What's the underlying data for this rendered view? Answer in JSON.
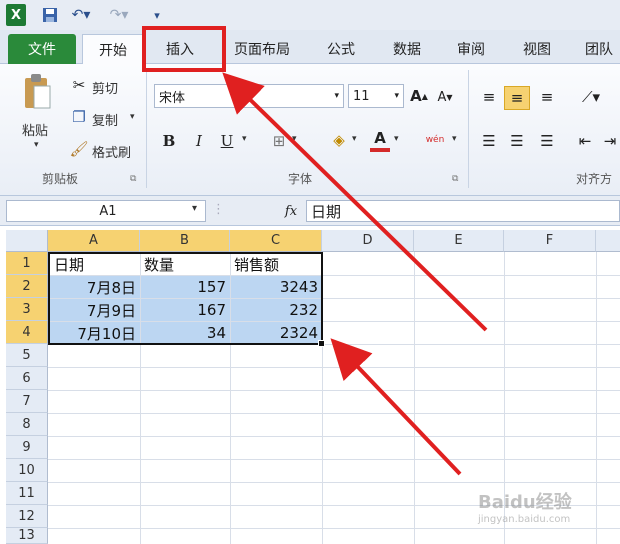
{
  "quick_access": {
    "app_icon": "excel-icon",
    "save": "save-icon",
    "undo": "undo-icon",
    "redo": "redo-icon",
    "customize": "customize-icon"
  },
  "tabs": [
    {
      "label": "文件"
    },
    {
      "label": "开始"
    },
    {
      "label": "插入"
    },
    {
      "label": "页面布局"
    },
    {
      "label": "公式"
    },
    {
      "label": "数据"
    },
    {
      "label": "审阅"
    },
    {
      "label": "视图"
    },
    {
      "label": "团队"
    }
  ],
  "clipboard": {
    "paste": "粘贴",
    "cut": "剪切",
    "copy": "复制",
    "format_painter": "格式刷",
    "group": "剪贴板"
  },
  "font": {
    "name": "宋体",
    "size": "11",
    "bold": "B",
    "italic": "I",
    "underline": "U",
    "font_color": "A",
    "phonetic": "wén",
    "group": "字体"
  },
  "alignment": {
    "group": "对齐方"
  },
  "formula_bar": {
    "name_box": "A1",
    "fx": "fx",
    "value": "日期"
  },
  "columns": [
    "A",
    "B",
    "C",
    "D",
    "E",
    "F"
  ],
  "rows": [
    "1",
    "2",
    "3",
    "4",
    "5",
    "6",
    "7",
    "8",
    "9",
    "10",
    "11",
    "12",
    "13"
  ],
  "table": {
    "headers": [
      "日期",
      "数量",
      "销售额"
    ],
    "data": [
      [
        "7月8日",
        "157",
        "3243"
      ],
      [
        "7月9日",
        "167",
        "232"
      ],
      [
        "7月10日",
        "34",
        "2324"
      ]
    ]
  },
  "watermark": {
    "logo": "Baidu经验",
    "url": "jingyan.baidu.com"
  },
  "colors": {
    "file_tab": "#2a8a3a",
    "selection": "#bcd6f2",
    "header_selected": "#f6d271",
    "annotation": "#e02020"
  }
}
